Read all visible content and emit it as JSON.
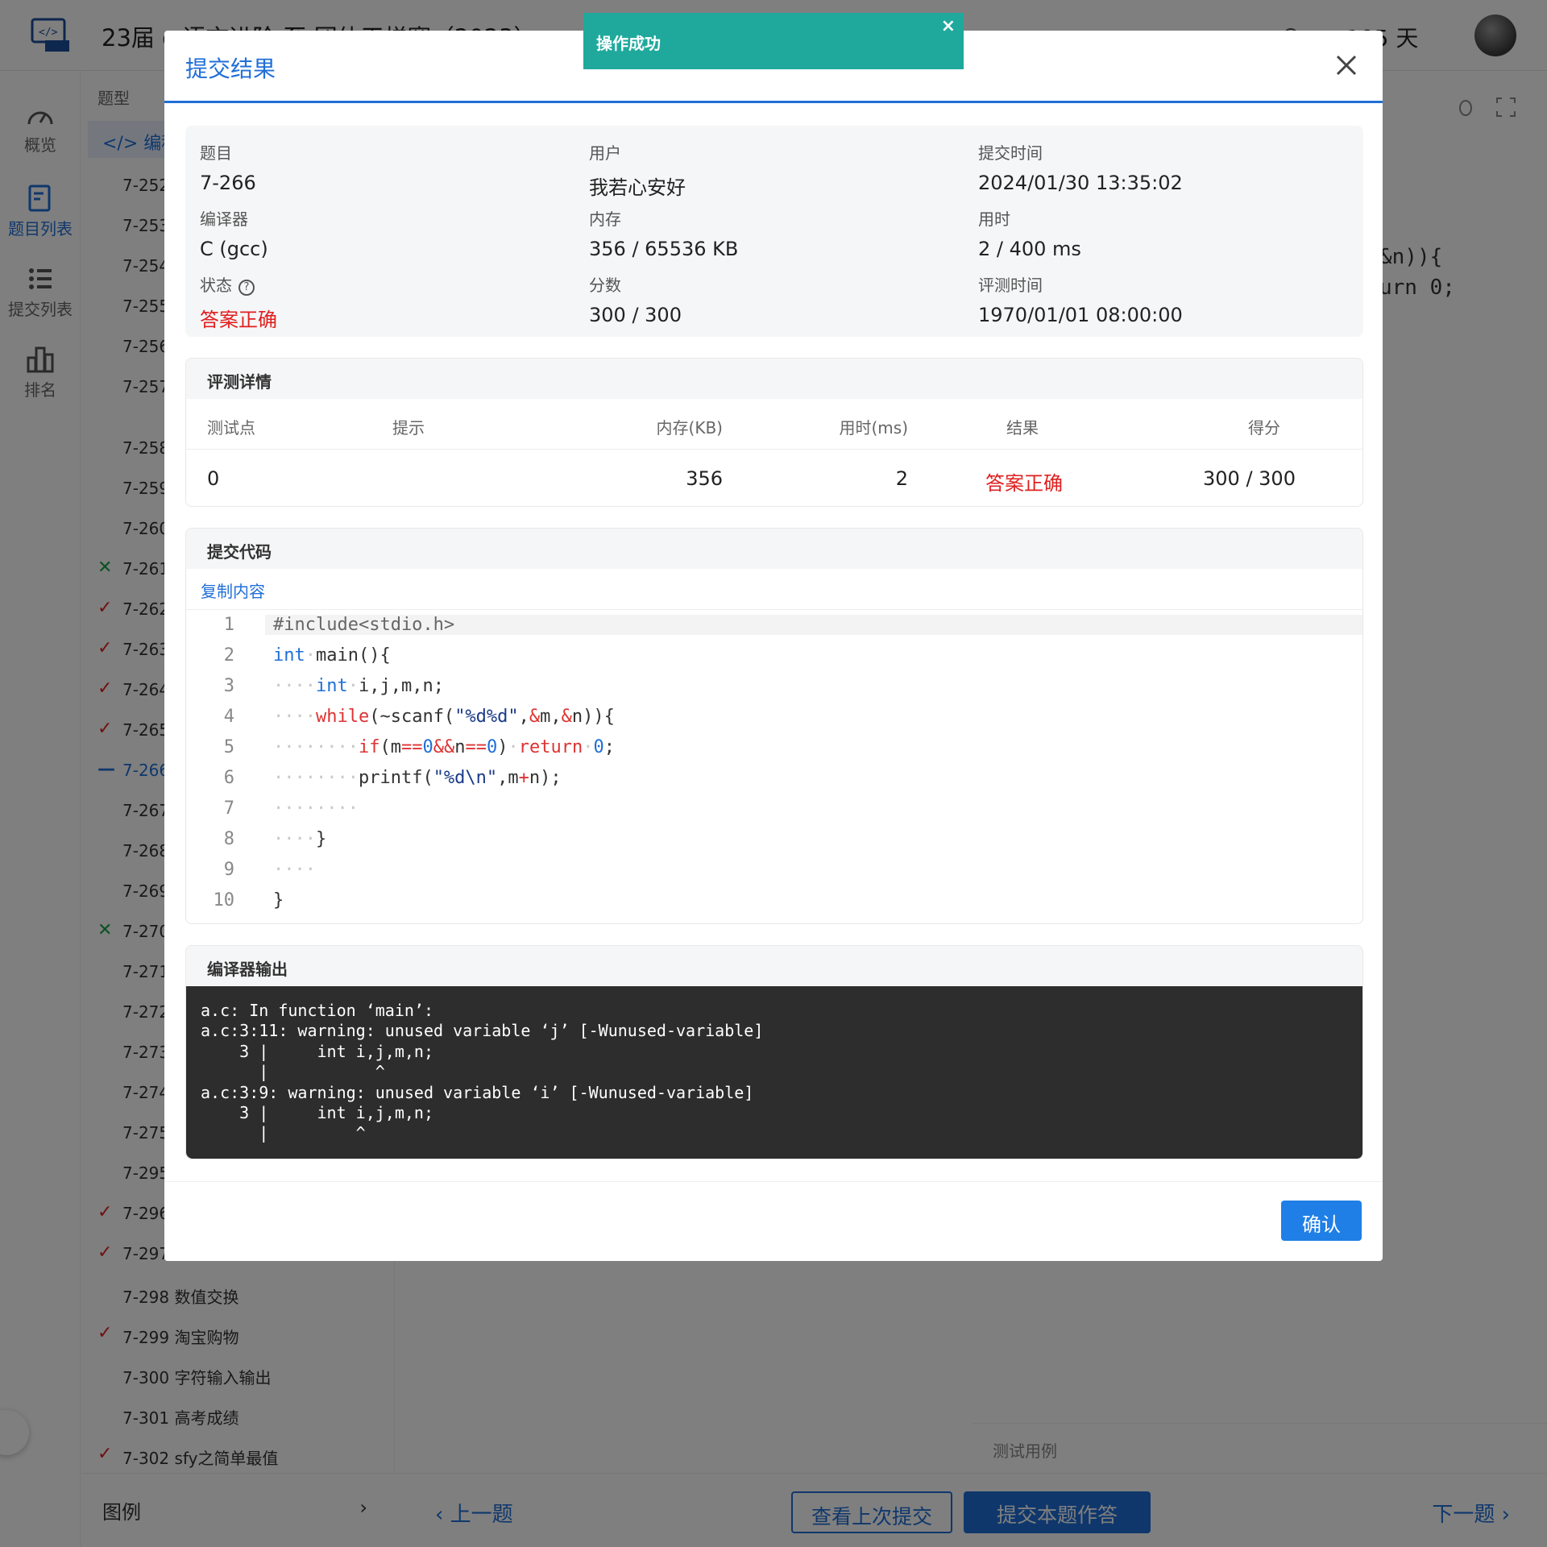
{
  "header": {
    "title": "23届 c 语言进阶 至 团体天梯赛（2023）",
    "days": "105 天"
  },
  "rail": {
    "overview": "概览",
    "problems": "题目列表",
    "submissions": "提交列表",
    "ranking": "排名"
  },
  "plist": {
    "head": "题型",
    "category": "编程题",
    "items": [
      {
        "mark": "",
        "text": "7-252",
        "state": "none"
      },
      {
        "mark": "",
        "text": "7-253",
        "state": "none"
      },
      {
        "mark": "",
        "text": "7-254",
        "state": "none"
      },
      {
        "mark": "",
        "text": "7-255",
        "state": "none"
      },
      {
        "mark": "",
        "text": "7-256",
        "state": "none"
      },
      {
        "mark": "",
        "text": "7-257",
        "state": "none"
      },
      {
        "mark": "",
        "text": "7-258",
        "state": "none"
      },
      {
        "mark": "",
        "text": "7-259",
        "state": "none"
      },
      {
        "mark": "",
        "text": "7-260",
        "state": "none"
      },
      {
        "mark": "✕",
        "text": "7-261",
        "state": "bad"
      },
      {
        "mark": "✓",
        "text": "7-262",
        "state": "ok"
      },
      {
        "mark": "✓",
        "text": "7-263",
        "state": "ok"
      },
      {
        "mark": "✓",
        "text": "7-264",
        "state": "ok"
      },
      {
        "mark": "✓",
        "text": "7-265",
        "state": "ok"
      },
      {
        "mark": "—",
        "text": "7-266",
        "state": "cur"
      },
      {
        "mark": "",
        "text": "7-267",
        "state": "none"
      },
      {
        "mark": "",
        "text": "7-268",
        "state": "none"
      },
      {
        "mark": "",
        "text": "7-269",
        "state": "none"
      },
      {
        "mark": "✕",
        "text": "7-270",
        "state": "bad"
      },
      {
        "mark": "",
        "text": "7-271",
        "state": "none"
      },
      {
        "mark": "",
        "text": "7-272",
        "state": "none"
      },
      {
        "mark": "",
        "text": "7-273",
        "state": "none"
      },
      {
        "mark": "",
        "text": "7-274",
        "state": "none"
      },
      {
        "mark": "",
        "text": "7-275",
        "state": "none"
      },
      {
        "mark": "",
        "text": "7-295",
        "state": "none"
      },
      {
        "mark": "✓",
        "text": "7-296",
        "state": "ok"
      },
      {
        "mark": "✓",
        "text": "7-297",
        "state": "ok"
      },
      {
        "mark": "",
        "text": "7-298 数值交换",
        "state": "none"
      },
      {
        "mark": "✓",
        "text": "7-299 淘宝购物",
        "state": "ok"
      },
      {
        "mark": "",
        "text": "7-300 字符输入输出",
        "state": "none"
      },
      {
        "mark": "",
        "text": "7-301 高考成绩",
        "state": "none"
      },
      {
        "mark": "✓",
        "text": "7-302 sfy之简单最值",
        "state": "ok"
      }
    ],
    "legend": "图例"
  },
  "editor_behind": {
    "line1": "&n)){",
    "line2": "urn 0;"
  },
  "testcase_label": "测试用例",
  "bottom": {
    "prev": "上一题",
    "view_last": "查看上次提交",
    "submit": "提交本题作答",
    "next": "下一题"
  },
  "toast": {
    "message": "操作成功",
    "close": "×"
  },
  "modal": {
    "title": "提交结果",
    "info": {
      "problem_label": "题目",
      "problem": "7-266",
      "user_label": "用户",
      "user": "我若心安好",
      "submit_time_label": "提交时间",
      "submit_time": "2024/01/30 13:35:02",
      "compiler_label": "编译器",
      "compiler": "C (gcc)",
      "memory_label": "内存",
      "memory": "356 / 65536 KB",
      "time_label": "用时",
      "time": "2 / 400 ms",
      "status_label": "状态",
      "status": "答案正确",
      "score_label": "分数",
      "score": "300 / 300",
      "judge_time_label": "评测时间",
      "judge_time": "1970/01/01 08:00:00"
    },
    "judge": {
      "title": "评测详情",
      "headers": {
        "case": "测试点",
        "hint": "提示",
        "mem": "内存(KB)",
        "time": "用时(ms)",
        "result": "结果",
        "score": "得分"
      },
      "row": {
        "case": "0",
        "hint": "",
        "mem": "356",
        "time": "2",
        "result": "答案正确",
        "score": "300 / 300"
      }
    },
    "code": {
      "title": "提交代码",
      "copy": "复制内容",
      "line_numbers": [
        "1",
        "2",
        "3",
        "4",
        "5",
        "6",
        "7",
        "8",
        "9",
        "10"
      ]
    },
    "compiler_output": {
      "title": "编译器输出",
      "text": "a.c: In function ‘main’:\na.c:3:11: warning: unused variable ‘j’ [-Wunused-variable]\n    3 |     int i,j,m,n;\n      |           ^\na.c:3:9: warning: unused variable ‘i’ [-Wunused-variable]\n    3 |     int i,j,m,n;\n      |         ^"
    },
    "confirm": "确认"
  },
  "colors": {
    "accent": "#1f6fd8",
    "success_toast": "#1fa99c",
    "correct": "#e02020",
    "wrong": "#1aa34a"
  }
}
